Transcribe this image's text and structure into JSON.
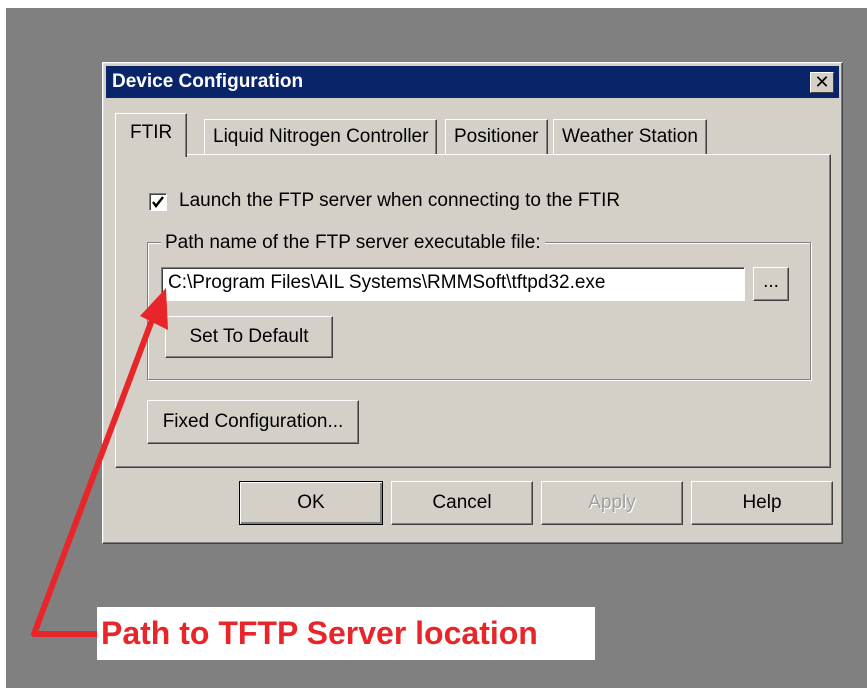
{
  "window": {
    "title": "Device Configuration",
    "close_glyph": "✕"
  },
  "tabs": [
    {
      "label": "FTIR",
      "active": true
    },
    {
      "label": "Liquid Nitrogen Controller",
      "active": false
    },
    {
      "label": "Positioner",
      "active": false
    },
    {
      "label": "Weather Station",
      "active": false
    }
  ],
  "ftir_panel": {
    "launch_checkbox_label": "Launch the FTP server when connecting to the FTIR",
    "launch_checkbox_checked": true,
    "path_group_label": "Path name of the FTP server executable file:",
    "path_value": "C:\\Program Files\\AIL Systems\\RMMSoft\\tftpd32.exe",
    "browse_label": "...",
    "set_default_label": "Set To Default",
    "fixed_config_label": "Fixed Configuration..."
  },
  "footer_buttons": {
    "ok": "OK",
    "cancel": "Cancel",
    "apply": "Apply",
    "help": "Help"
  },
  "annotation": {
    "caption": "Path to TFTP Server location",
    "color": "#e8262a"
  },
  "colors": {
    "desktop": "#808080",
    "dialog_face": "#d4d0c8",
    "titlebar": "#0a246a"
  }
}
